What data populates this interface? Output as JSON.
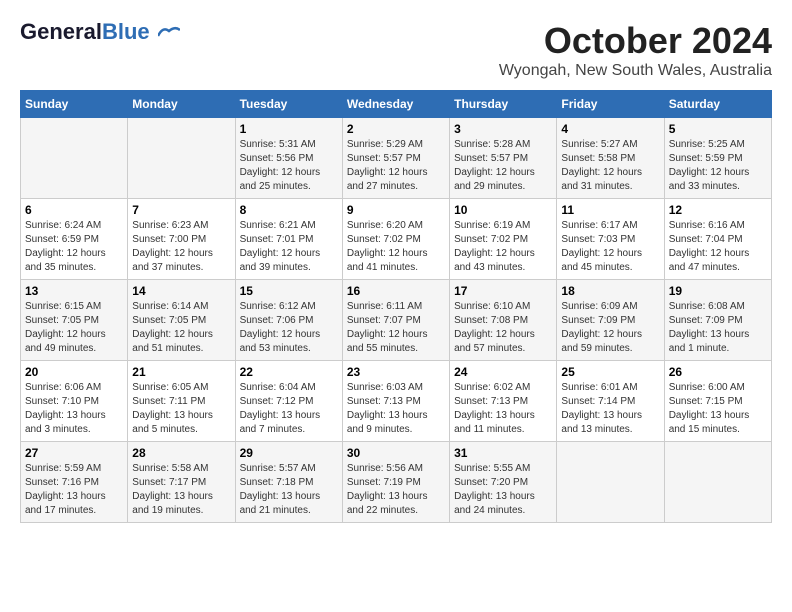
{
  "header": {
    "logo_line1": "General",
    "logo_line2": "Blue",
    "month": "October 2024",
    "location": "Wyongah, New South Wales, Australia"
  },
  "days_of_week": [
    "Sunday",
    "Monday",
    "Tuesday",
    "Wednesday",
    "Thursday",
    "Friday",
    "Saturday"
  ],
  "weeks": [
    [
      {
        "day": "",
        "info": ""
      },
      {
        "day": "",
        "info": ""
      },
      {
        "day": "1",
        "info": "Sunrise: 5:31 AM\nSunset: 5:56 PM\nDaylight: 12 hours\nand 25 minutes."
      },
      {
        "day": "2",
        "info": "Sunrise: 5:29 AM\nSunset: 5:57 PM\nDaylight: 12 hours\nand 27 minutes."
      },
      {
        "day": "3",
        "info": "Sunrise: 5:28 AM\nSunset: 5:57 PM\nDaylight: 12 hours\nand 29 minutes."
      },
      {
        "day": "4",
        "info": "Sunrise: 5:27 AM\nSunset: 5:58 PM\nDaylight: 12 hours\nand 31 minutes."
      },
      {
        "day": "5",
        "info": "Sunrise: 5:25 AM\nSunset: 5:59 PM\nDaylight: 12 hours\nand 33 minutes."
      }
    ],
    [
      {
        "day": "6",
        "info": "Sunrise: 6:24 AM\nSunset: 6:59 PM\nDaylight: 12 hours\nand 35 minutes."
      },
      {
        "day": "7",
        "info": "Sunrise: 6:23 AM\nSunset: 7:00 PM\nDaylight: 12 hours\nand 37 minutes."
      },
      {
        "day": "8",
        "info": "Sunrise: 6:21 AM\nSunset: 7:01 PM\nDaylight: 12 hours\nand 39 minutes."
      },
      {
        "day": "9",
        "info": "Sunrise: 6:20 AM\nSunset: 7:02 PM\nDaylight: 12 hours\nand 41 minutes."
      },
      {
        "day": "10",
        "info": "Sunrise: 6:19 AM\nSunset: 7:02 PM\nDaylight: 12 hours\nand 43 minutes."
      },
      {
        "day": "11",
        "info": "Sunrise: 6:17 AM\nSunset: 7:03 PM\nDaylight: 12 hours\nand 45 minutes."
      },
      {
        "day": "12",
        "info": "Sunrise: 6:16 AM\nSunset: 7:04 PM\nDaylight: 12 hours\nand 47 minutes."
      }
    ],
    [
      {
        "day": "13",
        "info": "Sunrise: 6:15 AM\nSunset: 7:05 PM\nDaylight: 12 hours\nand 49 minutes."
      },
      {
        "day": "14",
        "info": "Sunrise: 6:14 AM\nSunset: 7:05 PM\nDaylight: 12 hours\nand 51 minutes."
      },
      {
        "day": "15",
        "info": "Sunrise: 6:12 AM\nSunset: 7:06 PM\nDaylight: 12 hours\nand 53 minutes."
      },
      {
        "day": "16",
        "info": "Sunrise: 6:11 AM\nSunset: 7:07 PM\nDaylight: 12 hours\nand 55 minutes."
      },
      {
        "day": "17",
        "info": "Sunrise: 6:10 AM\nSunset: 7:08 PM\nDaylight: 12 hours\nand 57 minutes."
      },
      {
        "day": "18",
        "info": "Sunrise: 6:09 AM\nSunset: 7:09 PM\nDaylight: 12 hours\nand 59 minutes."
      },
      {
        "day": "19",
        "info": "Sunrise: 6:08 AM\nSunset: 7:09 PM\nDaylight: 13 hours\nand 1 minute."
      }
    ],
    [
      {
        "day": "20",
        "info": "Sunrise: 6:06 AM\nSunset: 7:10 PM\nDaylight: 13 hours\nand 3 minutes."
      },
      {
        "day": "21",
        "info": "Sunrise: 6:05 AM\nSunset: 7:11 PM\nDaylight: 13 hours\nand 5 minutes."
      },
      {
        "day": "22",
        "info": "Sunrise: 6:04 AM\nSunset: 7:12 PM\nDaylight: 13 hours\nand 7 minutes."
      },
      {
        "day": "23",
        "info": "Sunrise: 6:03 AM\nSunset: 7:13 PM\nDaylight: 13 hours\nand 9 minutes."
      },
      {
        "day": "24",
        "info": "Sunrise: 6:02 AM\nSunset: 7:13 PM\nDaylight: 13 hours\nand 11 minutes."
      },
      {
        "day": "25",
        "info": "Sunrise: 6:01 AM\nSunset: 7:14 PM\nDaylight: 13 hours\nand 13 minutes."
      },
      {
        "day": "26",
        "info": "Sunrise: 6:00 AM\nSunset: 7:15 PM\nDaylight: 13 hours\nand 15 minutes."
      }
    ],
    [
      {
        "day": "27",
        "info": "Sunrise: 5:59 AM\nSunset: 7:16 PM\nDaylight: 13 hours\nand 17 minutes."
      },
      {
        "day": "28",
        "info": "Sunrise: 5:58 AM\nSunset: 7:17 PM\nDaylight: 13 hours\nand 19 minutes."
      },
      {
        "day": "29",
        "info": "Sunrise: 5:57 AM\nSunset: 7:18 PM\nDaylight: 13 hours\nand 21 minutes."
      },
      {
        "day": "30",
        "info": "Sunrise: 5:56 AM\nSunset: 7:19 PM\nDaylight: 13 hours\nand 22 minutes."
      },
      {
        "day": "31",
        "info": "Sunrise: 5:55 AM\nSunset: 7:20 PM\nDaylight: 13 hours\nand 24 minutes."
      },
      {
        "day": "",
        "info": ""
      },
      {
        "day": "",
        "info": ""
      }
    ]
  ]
}
